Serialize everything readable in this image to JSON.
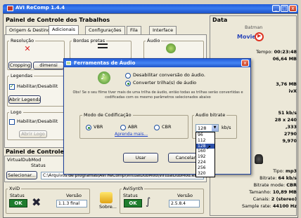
{
  "window": {
    "title": "AVI ReComp 1.4.4"
  },
  "main": {
    "panel_title": "Painel de Controle dos Trabalhos",
    "tabs": [
      {
        "label": "Origem & Destino"
      },
      {
        "label": "Adicionais"
      },
      {
        "label": "Configurações"
      },
      {
        "label": "Fila"
      },
      {
        "label": "Interface"
      }
    ],
    "groups": {
      "resolucao": "Resolução",
      "bordas": "Bordas pretas",
      "audio": "Áudio",
      "legendas": "Legendas",
      "logo": "Logo"
    },
    "cropping_label": "Cropping",
    "dimension_label": "dimensi",
    "habilitar_legenda": "Habilitar/Desabilit",
    "abrir_legenda": "Abrir Legenda",
    "habilitar_logo": "Habilitar/Desabilit",
    "abrir_logo": "Abrir Logo"
  },
  "lower_panel": {
    "title": "Painel de Controle d",
    "virtualdub_label": "VirtualDubMod",
    "status_label": "Status",
    "selecionar": "Selecionar...",
    "path": "C:\\Arquivos de programas\\AVI ReComp\\VirtualDubMod\\VirtualDubMod.ex"
  },
  "components": {
    "xvid": {
      "name": "XviD",
      "status_label": "Status",
      "status": "OK",
      "version_label": "Versão",
      "version": "1.1.3 final"
    },
    "sobre": "Sobre...",
    "avisynth": {
      "name": "AviSynth",
      "status_label": "Status",
      "status": "OK",
      "version_label": "Versão",
      "version": "2.5.8.4"
    }
  },
  "data_panel": {
    "title": "Data",
    "film_title": "Batman",
    "movie_label": "Movie",
    "rows_top": [
      {
        "label": "Tempo:",
        "value": "00:23:48"
      },
      {
        "label": "",
        "value": "06,64 MB"
      },
      {
        "label": "",
        "value": "3,76 MB"
      },
      {
        "label": "",
        "value": "ivX"
      },
      {
        "label": "",
        "value": "51 kb/s"
      },
      {
        "label": "",
        "value": "28 x 240"
      },
      {
        "label": "",
        "value": ",333"
      },
      {
        "label": "",
        "value": "2790"
      },
      {
        "label": "",
        "value": "9,970"
      }
    ],
    "rows_bottom": [
      {
        "label": "Tipo:",
        "value": "mp3"
      },
      {
        "label": "Bitrate:",
        "value": "64 kb/s"
      },
      {
        "label": "Bitrate mode:",
        "value": "CBR"
      },
      {
        "label": "Tamanho:",
        "value": "10,89 MB"
      },
      {
        "label": "Canais:",
        "value": "2 (stereo)"
      },
      {
        "label": "Sample rate:",
        "value": "44100 Hz"
      }
    ]
  },
  "dialog": {
    "title": "Ferramentas de Áudio",
    "radio_disable": "Desabilitar conversão do áudio.",
    "radio_convert": "Converter trilha(s) de áudio",
    "note": "Obs! Se o seu filme tiver mais de uma trilha de áudio, então todas as trilhas serão convertidas e codificadas com os mesmo parâmetros selecionados abaixo",
    "mode_group": "Modo de Codificação",
    "modes": [
      "VBR",
      "ABR",
      "CBR"
    ],
    "selected_mode": "VBR",
    "learn_more": "Aprenda mais...",
    "bitrate_group": "Audio bitrate",
    "bitrate_value": "128",
    "bitrate_unit": "kb/s",
    "bitrate_options": [
      "96",
      "112",
      "128",
      "160",
      "192",
      "224",
      "256",
      "320"
    ],
    "highlighted_option": "128",
    "usar": "Usar",
    "cancelar": "Cancelar"
  },
  "colors": {
    "titlebar": "#245edb",
    "ok_status": "#1f7d2e",
    "link": "#1a3fc8"
  }
}
